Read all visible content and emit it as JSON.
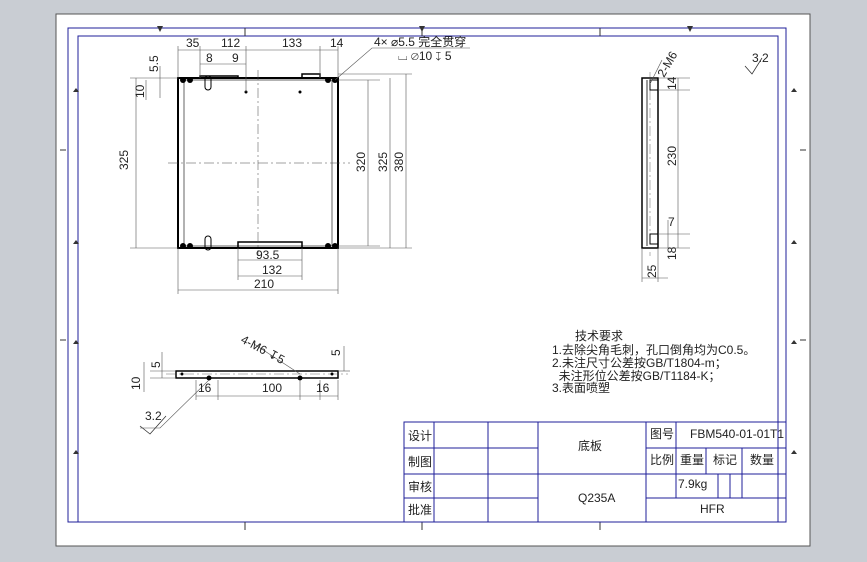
{
  "colors": {
    "background": "#c9cdd3",
    "paper": "#ffffff",
    "frame_blue": "#1f1f9a",
    "line": "#2a2a2a",
    "outline": "#000000",
    "dim_line": "#555555"
  },
  "plan_view": {
    "top_dims": [
      "35",
      "112",
      "133",
      "14"
    ],
    "sub_dims": [
      "8",
      "9"
    ],
    "left_dims": [
      "5.5",
      "10",
      "325"
    ],
    "right_dims": [
      "320",
      "325",
      "380"
    ],
    "bottom_dims": [
      "93.5",
      "132",
      "210"
    ],
    "hole_callout_line1": "4× ⌀5.5  完全贯穿",
    "hole_callout_line2": "⌴ ⌀10 ↧ 5"
  },
  "side_view": {
    "thread_callout": "2-M6",
    "dims": [
      "14",
      "230",
      "7",
      "18",
      "25"
    ],
    "roughness": "3.2"
  },
  "bottom_view": {
    "thread_callout": "4-M6 ↧5",
    "dims": [
      "5",
      "10",
      "16",
      "100",
      "16",
      "5"
    ],
    "roughness": "3.2"
  },
  "notes": {
    "title": "技术要求",
    "items": [
      "1.去除尖角毛刺，孔口倒角均为C0.5。",
      "2.未注尺寸公差按GB/T1804-m；",
      "  未注形位公差按GB/T1184-K；",
      "3.表面喷塑"
    ]
  },
  "title_block": {
    "design_label": "设计",
    "draw_label": "制图",
    "check_label": "审核",
    "approve_label": "批准",
    "part_name": "底板",
    "material": "Q235A",
    "drawing_no_label": "图号",
    "drawing_no": "FBM540-01-01T1",
    "scale_label": "比例",
    "weight_label": "重量",
    "mark_label": "标记",
    "qty_label": "数量",
    "weight_value": "7.9kg",
    "company": "HFR"
  }
}
